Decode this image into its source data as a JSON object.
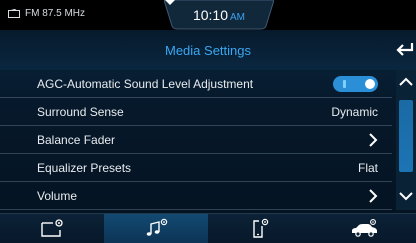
{
  "status_bar": {
    "radio_icon": "radio-icon",
    "radio_station": "FM 87.5 MHz",
    "time": "10:10",
    "ampm": "AM"
  },
  "header": {
    "title": "Media Settings",
    "back_icon": "back-arrow-icon"
  },
  "settings": [
    {
      "label": "AGC-Automatic Sound Level Adjustment",
      "control": "toggle",
      "toggle_state": "on"
    },
    {
      "label": "Surround Sense",
      "control": "value",
      "value": "Dynamic"
    },
    {
      "label": "Balance Fader",
      "control": "chevron"
    },
    {
      "label": "Equalizer Presets",
      "control": "value",
      "value": "Flat"
    },
    {
      "label": "Volume",
      "control": "chevron"
    }
  ],
  "scrollbar": {
    "up_icon": "chevron-up-icon",
    "down_icon": "chevron-down-icon"
  },
  "bottom_nav": [
    {
      "icon": "screen-settings-icon",
      "active": false
    },
    {
      "icon": "music-settings-icon",
      "active": true
    },
    {
      "icon": "phone-settings-icon",
      "active": false
    },
    {
      "icon": "car-settings-icon",
      "active": false
    }
  ],
  "colors": {
    "accent": "#3aa7f2",
    "toggle_on": "#2a8fd6",
    "text": "#e8ecef",
    "background": "#06182a"
  }
}
